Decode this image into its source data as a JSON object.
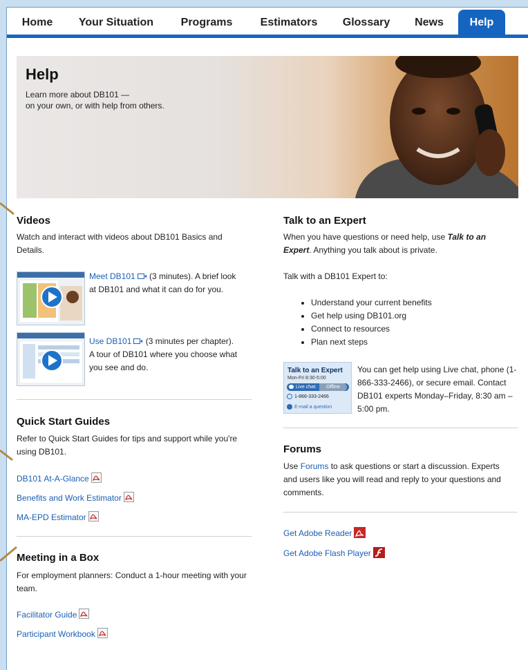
{
  "nav": {
    "tabs": [
      {
        "label": "Home"
      },
      {
        "label": "Your Situation"
      },
      {
        "label": "Programs"
      },
      {
        "label": "Estimators"
      },
      {
        "label": "Glossary"
      },
      {
        "label": "News"
      },
      {
        "label": "Help"
      }
    ],
    "active": "Help"
  },
  "hero": {
    "title": "Help",
    "subtitle_line1": "Learn more about DB101 —",
    "subtitle_line2": "on your own, or with help from others."
  },
  "videos": {
    "heading": "Videos",
    "intro": "Watch and interact with videos about DB101 Basics and Details.",
    "items": [
      {
        "link": "Meet DB101",
        "rest_line1": " (3 minutes). A brief look",
        "rest_line2": "at DB101 and what it can do for you."
      },
      {
        "link": "Use DB101",
        "rest_line1": " (3 minutes per chapter).",
        "rest_line2": "A tour of DB101 where you choose what",
        "rest_line3": "you see and do."
      }
    ]
  },
  "quickstart": {
    "heading": "Quick Start Guides",
    "intro": "Refer to Quick Start Guides for tips and support while you're using DB101.",
    "links": [
      "DB101 At-A-Glance",
      "Benefits and Work Estimator",
      "MA-EPD Estimator"
    ]
  },
  "meeting": {
    "heading": "Meeting in a Box",
    "intro": "For employment planners: Conduct a 1-hour meeting with your team.",
    "links": [
      "Facilitator Guide",
      "Participant Workbook"
    ]
  },
  "expert": {
    "heading": "Talk to an Expert",
    "intro_before": "When you have questions or need help, use ",
    "intro_em": "Talk to an Expert",
    "intro_after": ". Anything you talk about is private.",
    "lead": "Talk with a DB101 Expert to:",
    "bullets": [
      "Understand your current benefits",
      "Get help using DB101.org",
      "Connect to resources",
      "Plan next steps"
    ],
    "widget_title": "Talk to an Expert",
    "widget_hours": "Mon-Fri 8:30-5:00",
    "widget_chat": "Live chat:",
    "widget_status": "Offline",
    "widget_phone": "1-866-333-2466",
    "widget_email": "E-mail a question",
    "contact": "You can get help using Live chat, phone (1-866-333-2466), or secure email. Contact DB101 experts Monday–Friday, 8:30 am – 5:00 pm."
  },
  "forums": {
    "heading": "Forums",
    "before": "Use ",
    "link": "Forums",
    "after": " to ask questions or start a discussion. Experts and users like you will read and reply to your questions and comments."
  },
  "downloads": {
    "reader": "Get Adobe Reader",
    "flash": "Get Adobe Flash Player"
  },
  "colors": {
    "brand_blue": "#1565c0",
    "link": "#1a5fb4",
    "pdf_red": "#c62828"
  }
}
